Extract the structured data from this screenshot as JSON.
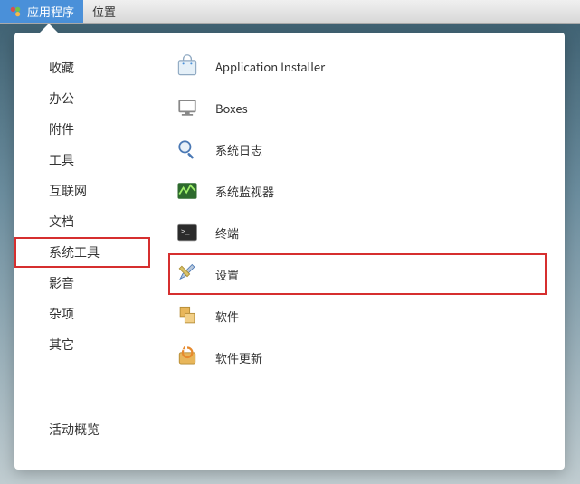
{
  "topbar": {
    "applications": "应用程序",
    "places": "位置"
  },
  "sidebar": {
    "items": [
      {
        "label": "收藏"
      },
      {
        "label": "办公"
      },
      {
        "label": "附件"
      },
      {
        "label": "工具"
      },
      {
        "label": "互联网"
      },
      {
        "label": "文档"
      },
      {
        "label": "系统工具",
        "highlighted": true
      },
      {
        "label": "影音"
      },
      {
        "label": "杂项"
      },
      {
        "label": "其它"
      }
    ],
    "activities": "活动概览"
  },
  "apps": [
    {
      "icon": "installer",
      "label": "Application Installer"
    },
    {
      "icon": "boxes",
      "label": "Boxes"
    },
    {
      "icon": "logs",
      "label": "系统日志"
    },
    {
      "icon": "monitor",
      "label": "系统监视器"
    },
    {
      "icon": "terminal",
      "label": "终端"
    },
    {
      "icon": "settings",
      "label": "设置",
      "highlighted": true
    },
    {
      "icon": "software",
      "label": "软件"
    },
    {
      "icon": "update",
      "label": "软件更新"
    }
  ]
}
